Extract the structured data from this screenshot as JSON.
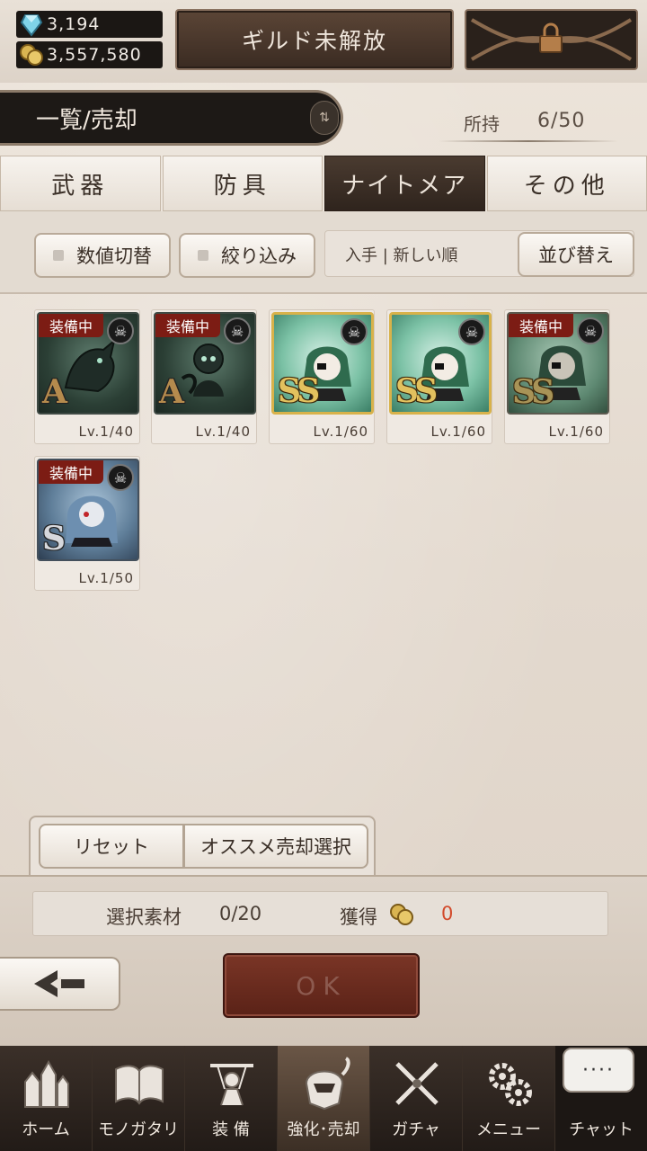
{
  "currency": {
    "gems": "3,194",
    "coins": "3,557,580"
  },
  "header": {
    "guild_label": "ギルド未解放"
  },
  "title": {
    "label": "一覧/売却",
    "owned_label": "所持",
    "owned_value": "6/50"
  },
  "tabs": [
    {
      "label": "武器",
      "active": false
    },
    {
      "label": "防具",
      "active": false
    },
    {
      "label": "ナイトメア",
      "active": true
    },
    {
      "label": "その他",
      "active": false
    }
  ],
  "filters": {
    "toggle_values": "数値切替",
    "narrow": "絞り込み",
    "sort_current": "入手 | 新しい順",
    "sort_button": "並び替え"
  },
  "items": [
    {
      "equipped": true,
      "equipped_label": "装備中",
      "rank": "A",
      "level": "Lv.1/40"
    },
    {
      "equipped": true,
      "equipped_label": "装備中",
      "rank": "A",
      "level": "Lv.1/40"
    },
    {
      "equipped": false,
      "equipped_label": "",
      "rank": "SS",
      "level": "Lv.1/60"
    },
    {
      "equipped": false,
      "equipped_label": "",
      "rank": "SS",
      "level": "Lv.1/60"
    },
    {
      "equipped": true,
      "equipped_label": "装備中",
      "rank": "SS",
      "level": "Lv.1/60"
    },
    {
      "equipped": true,
      "equipped_label": "装備中",
      "rank": "S",
      "level": "Lv.1/50"
    }
  ],
  "actions": {
    "reset": "リセット",
    "recommend": "オススメ売却選択"
  },
  "summary": {
    "selected_label": "選択素材",
    "selected_value": "0/20",
    "gain_label": "獲得",
    "gain_value": "0"
  },
  "ok_label": "OK",
  "nav": [
    {
      "label": "ホーム",
      "icon": "castle-icon"
    },
    {
      "label": "モノガタリ",
      "icon": "book-icon"
    },
    {
      "label": "装 備",
      "icon": "puppet-icon"
    },
    {
      "label": "強化･売却",
      "icon": "helmet-icon"
    },
    {
      "label": "ガチャ",
      "icon": "swords-icon"
    },
    {
      "label": "メニュー",
      "icon": "gears-icon"
    },
    {
      "label": "チャット",
      "icon": "chat-bubble-icon"
    }
  ],
  "colors": {
    "active_tab": "#3a2c23",
    "equip_badge": "#7c1c14",
    "gain_value": "#d2492a",
    "gold_rank": "#e2c15e"
  }
}
